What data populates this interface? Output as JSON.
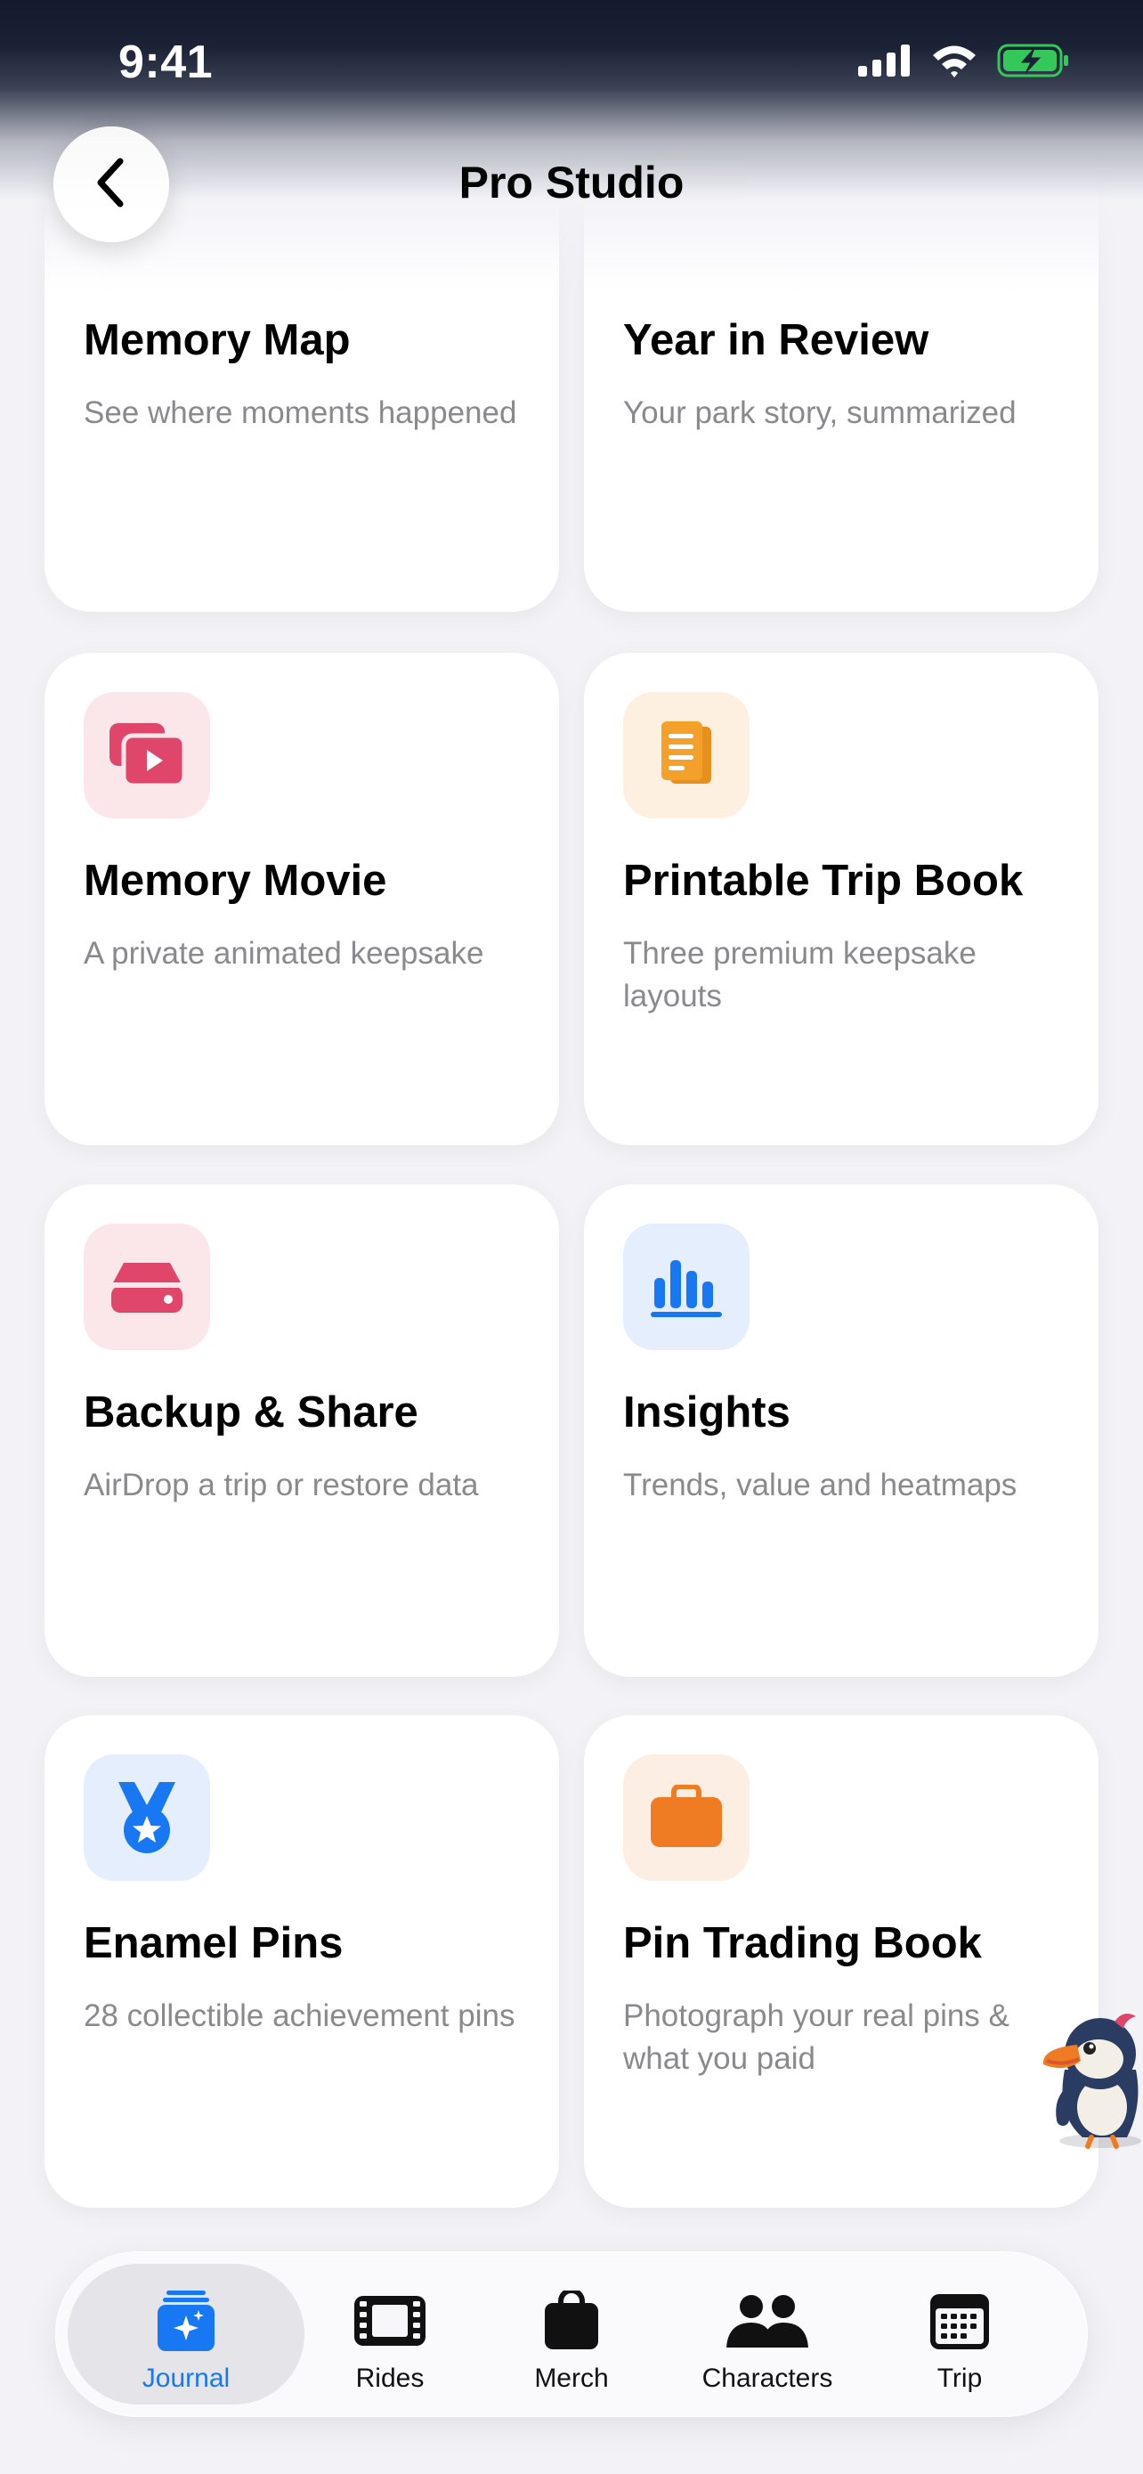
{
  "status_bar": {
    "time": "9:41"
  },
  "nav": {
    "title": "Pro Studio"
  },
  "cards": [
    {
      "title": "Memory Map",
      "subtitle": "See where moments happened",
      "icon": "map-icon"
    },
    {
      "title": "Year in Review",
      "subtitle": "Your park story, summarized",
      "icon": "photo-sparkle-icon"
    },
    {
      "title": "Memory Movie",
      "subtitle": "A private animated keepsake",
      "icon": "video-stack-icon"
    },
    {
      "title": "Printable Trip Book",
      "subtitle": "Three premium keepsake layouts",
      "icon": "book-pages-icon"
    },
    {
      "title": "Backup & Share",
      "subtitle": "AirDrop a trip or restore data",
      "icon": "drive-icon"
    },
    {
      "title": "Insights",
      "subtitle": "Trends, value and heatmaps",
      "icon": "bar-chart-icon"
    },
    {
      "title": "Enamel Pins",
      "subtitle": "28 collectible achievement pins",
      "icon": "medal-icon"
    },
    {
      "title": "Pin Trading Book",
      "subtitle": "Photograph your real pins & what you paid",
      "icon": "briefcase-icon"
    }
  ],
  "tabs": [
    {
      "label": "Journal",
      "icon": "journal-sparkle-icon",
      "active": true
    },
    {
      "label": "Rides",
      "icon": "film-icon",
      "active": false
    },
    {
      "label": "Merch",
      "icon": "bag-icon",
      "active": false
    },
    {
      "label": "Characters",
      "icon": "people-icon",
      "active": false
    },
    {
      "label": "Trip",
      "icon": "calendar-icon",
      "active": false
    }
  ],
  "colors": {
    "accent": "#1877f2",
    "pink": "#e0456a",
    "orange": "#f4a12b",
    "blue": "#1877f2",
    "briefcase": "#ef7c23",
    "battery": "#34c759"
  }
}
